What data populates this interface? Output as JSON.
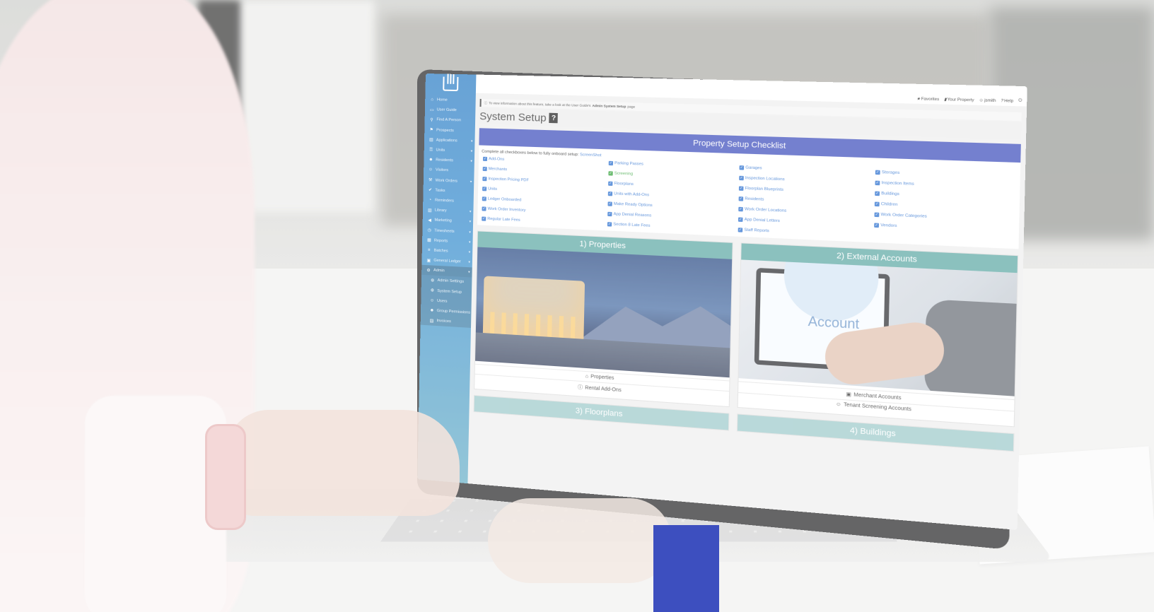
{
  "app": {
    "topbar": {
      "favorites": "Favorites",
      "your_property": "Your Property",
      "user": "jsmith",
      "help": "Help"
    },
    "info_banner": {
      "prefix": "To view information about this feature, take a look at the User Guide's",
      "link": "Admin System Setup",
      "suffix": "page"
    },
    "page_title": "System Setup",
    "help_badge": "?",
    "sidebar": {
      "items": [
        {
          "label": "Home",
          "icon": "home-icon",
          "glyph": "⌂"
        },
        {
          "label": "User Guide",
          "icon": "book-icon",
          "glyph": "▭"
        },
        {
          "label": "Find A Person",
          "icon": "search-icon",
          "glyph": "⚲"
        },
        {
          "label": "Prospects",
          "icon": "flag-icon",
          "glyph": "⚑"
        },
        {
          "label": "Applications",
          "icon": "file-icon",
          "glyph": "▤",
          "caret": true
        },
        {
          "label": "Units",
          "icon": "key-icon",
          "glyph": "⚿",
          "caret": true
        },
        {
          "label": "Residents",
          "icon": "users-icon",
          "glyph": "☻",
          "caret": true
        },
        {
          "label": "Visitors",
          "icon": "user-icon",
          "glyph": "☺"
        },
        {
          "label": "Work Orders",
          "icon": "wrench-icon",
          "glyph": "⚒",
          "caret": true
        },
        {
          "label": "Tasks",
          "icon": "check-icon",
          "glyph": "✔"
        },
        {
          "label": "Reminders",
          "icon": "bell-icon",
          "glyph": "◔"
        },
        {
          "label": "Library",
          "icon": "folder-icon",
          "glyph": "▥",
          "caret": true
        },
        {
          "label": "Marketing",
          "icon": "bullhorn-icon",
          "glyph": "◀",
          "caret": true
        },
        {
          "label": "Timesheets",
          "icon": "clock-icon",
          "glyph": "◷",
          "caret": true
        },
        {
          "label": "Reports",
          "icon": "chart-icon",
          "glyph": "▦",
          "caret": true
        },
        {
          "label": "Batches",
          "icon": "layers-icon",
          "glyph": "≡",
          "caret": true
        },
        {
          "label": "General Ledger",
          "icon": "ledger-icon",
          "glyph": "▣",
          "caret": true
        },
        {
          "label": "Admin",
          "icon": "gear-icon",
          "glyph": "⚙",
          "caret": true,
          "active": true
        },
        {
          "label": "Admin Settings",
          "icon": "sliders-icon",
          "glyph": "⚙",
          "sub": true
        },
        {
          "label": "System Setup",
          "icon": "cog-icon",
          "glyph": "⚙",
          "sub": true
        },
        {
          "label": "Users",
          "icon": "user-icon",
          "glyph": "☺",
          "sub": true
        },
        {
          "label": "Group Permissions",
          "icon": "users-icon",
          "glyph": "☻",
          "sub": true
        },
        {
          "label": "Invoices",
          "icon": "file-icon",
          "glyph": "▤",
          "sub": true
        }
      ]
    },
    "checklist": {
      "title": "Property Setup Checklist",
      "note": "Complete all checkboxes below to fully onboard setup:",
      "note_link": "ScreenShot",
      "columns": [
        [
          {
            "label": "Add-Ons",
            "done": false
          },
          {
            "label": "Merchants",
            "done": false
          },
          {
            "label": "Inspection Pricing PDF",
            "done": false
          },
          {
            "label": "Units",
            "done": false
          },
          {
            "label": "Ledger Onboarded",
            "done": false
          },
          {
            "label": "Work Order Inventory",
            "done": false
          },
          {
            "label": "Regular Late Fees",
            "done": false
          }
        ],
        [
          {
            "label": "Parking Passes",
            "done": false
          },
          {
            "label": "Screening",
            "done": true
          },
          {
            "label": "Floorplans",
            "done": false
          },
          {
            "label": "Units with Add-Ons",
            "done": false
          },
          {
            "label": "Make Ready Options",
            "done": false
          },
          {
            "label": "App Denial Reasons",
            "done": false
          },
          {
            "label": "Section 8 Late Fees",
            "done": false
          }
        ],
        [
          {
            "label": "Garages",
            "done": false
          },
          {
            "label": "Inspection Locations",
            "done": false
          },
          {
            "label": "Floorplan Blueprints",
            "done": false
          },
          {
            "label": "Residents",
            "done": false
          },
          {
            "label": "Work Order Locations",
            "done": false
          },
          {
            "label": "App Denial Letters",
            "done": false
          },
          {
            "label": "Staff Reports",
            "done": false
          }
        ],
        [
          {
            "label": "Storages",
            "done": false
          },
          {
            "label": "Inspection Items",
            "done": false
          },
          {
            "label": "Buildings",
            "done": false
          },
          {
            "label": "Children",
            "done": false
          },
          {
            "label": "Work Order Categories",
            "done": false
          },
          {
            "label": "Vendors",
            "done": false
          }
        ]
      ]
    },
    "cards": [
      {
        "title": "1) Properties",
        "image": "villa-photo",
        "links": [
          {
            "label": "Properties",
            "icon": "building-icon",
            "glyph": "⌂"
          },
          {
            "label": "Rental Add-Ons",
            "icon": "info-icon",
            "glyph": "ⓘ"
          }
        ]
      },
      {
        "title": "2) External Accounts",
        "image": "account-photo",
        "links": [
          {
            "label": "Merchant Accounts",
            "icon": "card-icon",
            "glyph": "▣"
          },
          {
            "label": "Tenant Screening Accounts",
            "icon": "user-plus-icon",
            "glyph": "☺"
          }
        ]
      }
    ],
    "cards_next": [
      "3) Floorplans",
      "4) Buildings"
    ],
    "photo_word": "Account"
  },
  "colors": {
    "accent": "#3d4fbf",
    "header_blue": "#3f4fbd",
    "card_teal": "#5fa9a6",
    "link_blue": "#2a6fcf",
    "done_green": "#35a33b",
    "sidebar": "#2f7fc6"
  }
}
